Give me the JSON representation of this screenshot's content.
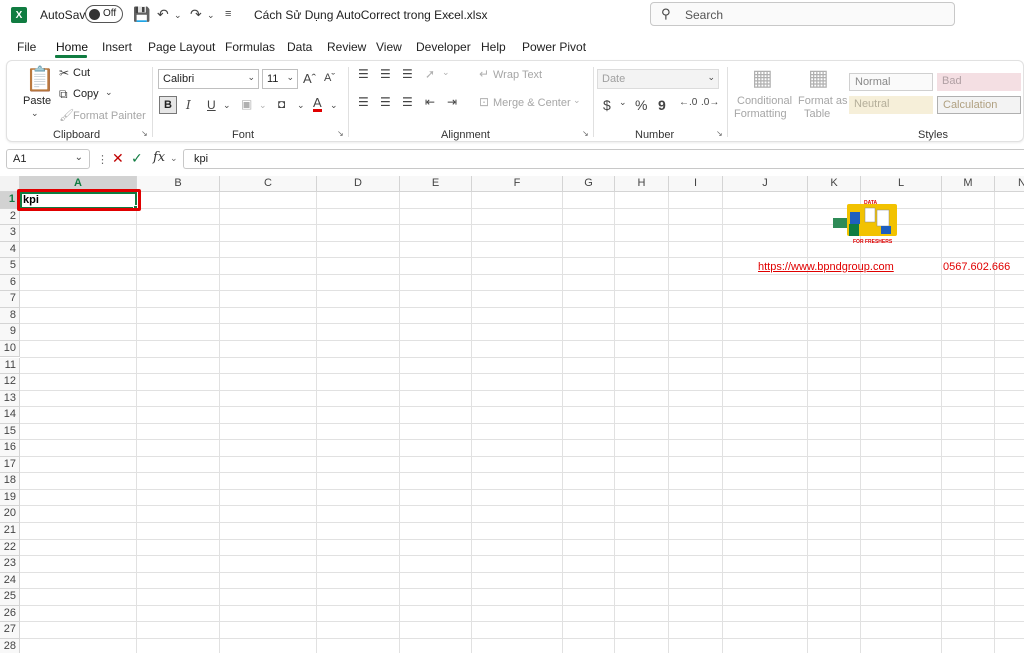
{
  "titlebar": {
    "app_icon": "excel-logo-icon",
    "app_icon_letter": "X",
    "autosave_label": "AutoSave",
    "autosave_state": "Off",
    "document_title": "Cách Sử Dụng AutoCorrect trong Excel.xlsx",
    "search_placeholder": "Search"
  },
  "tabs": [
    "File",
    "Home",
    "Insert",
    "Page Layout",
    "Formulas",
    "Data",
    "Review",
    "View",
    "Developer",
    "Help",
    "Power Pivot"
  ],
  "active_tab": "Home",
  "ribbon": {
    "clipboard": {
      "paste": "Paste",
      "cut": "Cut",
      "copy": "Copy",
      "format_painter": "Format Painter",
      "label": "Clipboard"
    },
    "font": {
      "font_name": "Calibri",
      "font_size": "11",
      "bold": "B",
      "italic": "I",
      "underline": "U",
      "font_color_letter": "A",
      "label": "Font"
    },
    "alignment": {
      "wrap_text": "Wrap Text",
      "merge_center": "Merge & Center",
      "label": "Alignment"
    },
    "number": {
      "format": "Date",
      "currency": "$",
      "percent": "%",
      "comma": "9",
      "label": "Number"
    },
    "styles": {
      "conditional_formatting_1": "Conditional",
      "conditional_formatting_2": "Formatting",
      "format_as_table_1": "Format as",
      "format_as_table_2": "Table",
      "normal": "Normal",
      "bad": "Bad",
      "neutral": "Neutral",
      "calculation": "Calculation",
      "label": "Styles"
    }
  },
  "formula_bar": {
    "name_box": "A1",
    "fx": "fx",
    "content": "kpi"
  },
  "grid": {
    "columns": [
      "A",
      "B",
      "C",
      "D",
      "E",
      "F",
      "G",
      "H",
      "I",
      "J",
      "K",
      "L",
      "M",
      "N"
    ],
    "rows": [
      "1",
      "2",
      "3",
      "4",
      "5",
      "6",
      "7",
      "8",
      "9",
      "10",
      "11",
      "12",
      "13",
      "14",
      "15",
      "16",
      "17",
      "18",
      "19",
      "20",
      "21",
      "22",
      "23",
      "24",
      "25",
      "26",
      "27",
      "28"
    ],
    "selected_col": "A",
    "selected_row": "1",
    "cells": {
      "A1": "kpi",
      "J5": "https://www.bpndgroup.com",
      "M5": "0567.602.666"
    },
    "logo_text": "DATA",
    "logo_caption": "FOR FRESHERS"
  },
  "colors": {
    "excel_green": "#107c41",
    "highlight_red": "#e00000"
  }
}
